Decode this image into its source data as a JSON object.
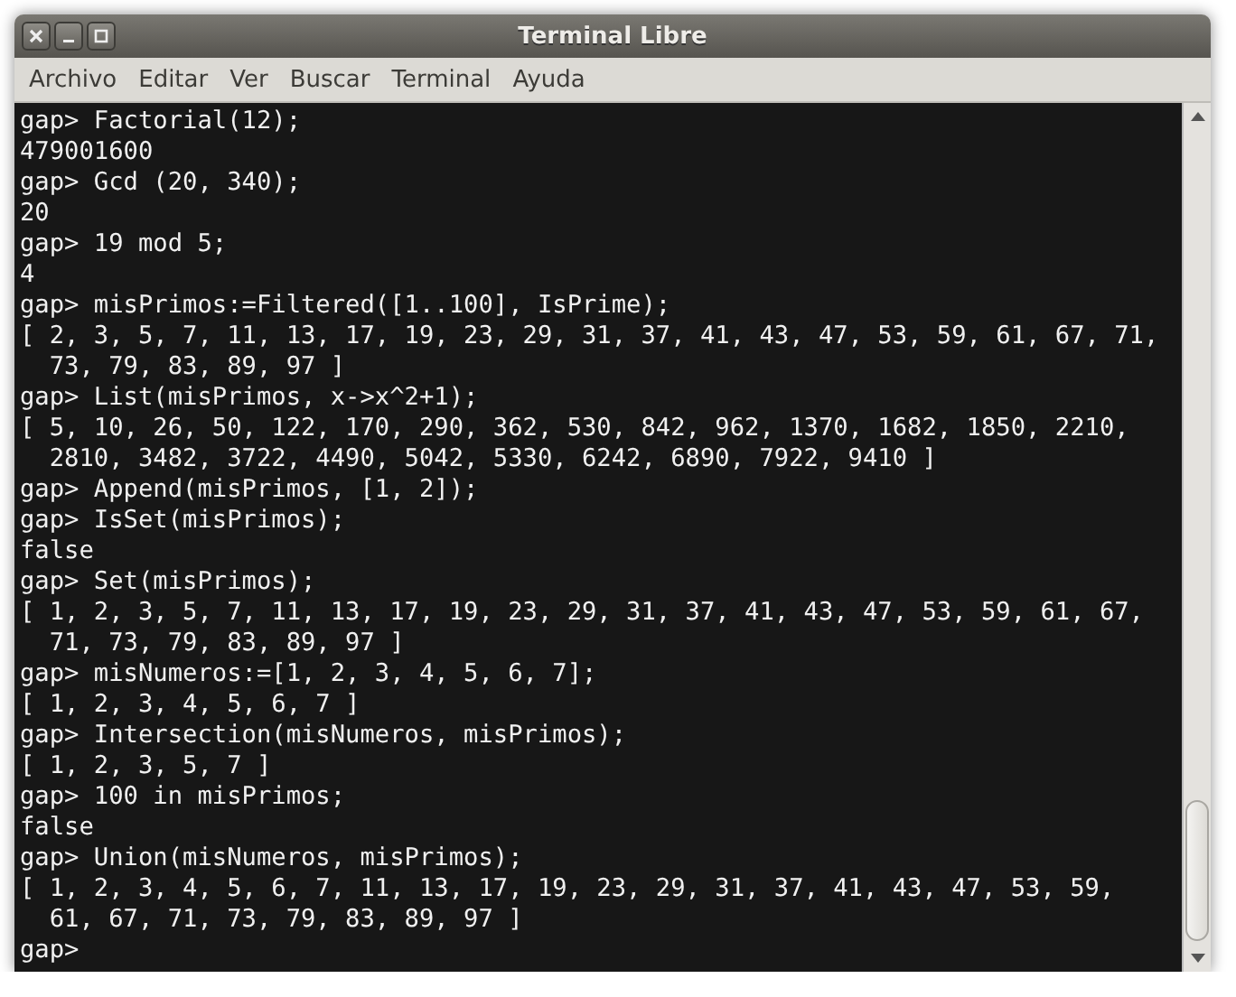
{
  "window": {
    "title": "Terminal Libre"
  },
  "menu": [
    "Archivo",
    "Editar",
    "Ver",
    "Buscar",
    "Terminal",
    "Ayuda"
  ],
  "terminal_lines": [
    "gap> Factorial(12);",
    "479001600",
    "gap> Gcd (20, 340);",
    "20",
    "gap> 19 mod 5;",
    "4",
    "gap> misPrimos:=Filtered([1..100], IsPrime);",
    "[ 2, 3, 5, 7, 11, 13, 17, 19, 23, 29, 31, 37, 41, 43, 47, 53, 59, 61, 67, 71,",
    "  73, 79, 83, 89, 97 ]",
    "gap> List(misPrimos, x->x^2+1);",
    "[ 5, 10, 26, 50, 122, 170, 290, 362, 530, 842, 962, 1370, 1682, 1850, 2210,",
    "  2810, 3482, 3722, 4490, 5042, 5330, 6242, 6890, 7922, 9410 ]",
    "gap> Append(misPrimos, [1, 2]);",
    "gap> IsSet(misPrimos);",
    "false",
    "gap> Set(misPrimos);",
    "[ 1, 2, 3, 5, 7, 11, 13, 17, 19, 23, 29, 31, 37, 41, 43, 47, 53, 59, 61, 67,",
    "  71, 73, 79, 83, 89, 97 ]",
    "gap> misNumeros:=[1, 2, 3, 4, 5, 6, 7];",
    "[ 1, 2, 3, 4, 5, 6, 7 ]",
    "gap> Intersection(misNumeros, misPrimos);",
    "[ 1, 2, 3, 5, 7 ]",
    "gap> 100 in misPrimos;",
    "false",
    "gap> Union(misNumeros, misPrimos);",
    "[ 1, 2, 3, 4, 5, 6, 7, 11, 13, 17, 19, 23, 29, 31, 37, 41, 43, 47, 53, 59,",
    "  61, 67, 71, 73, 79, 83, 89, 97 ]",
    "gap>"
  ]
}
